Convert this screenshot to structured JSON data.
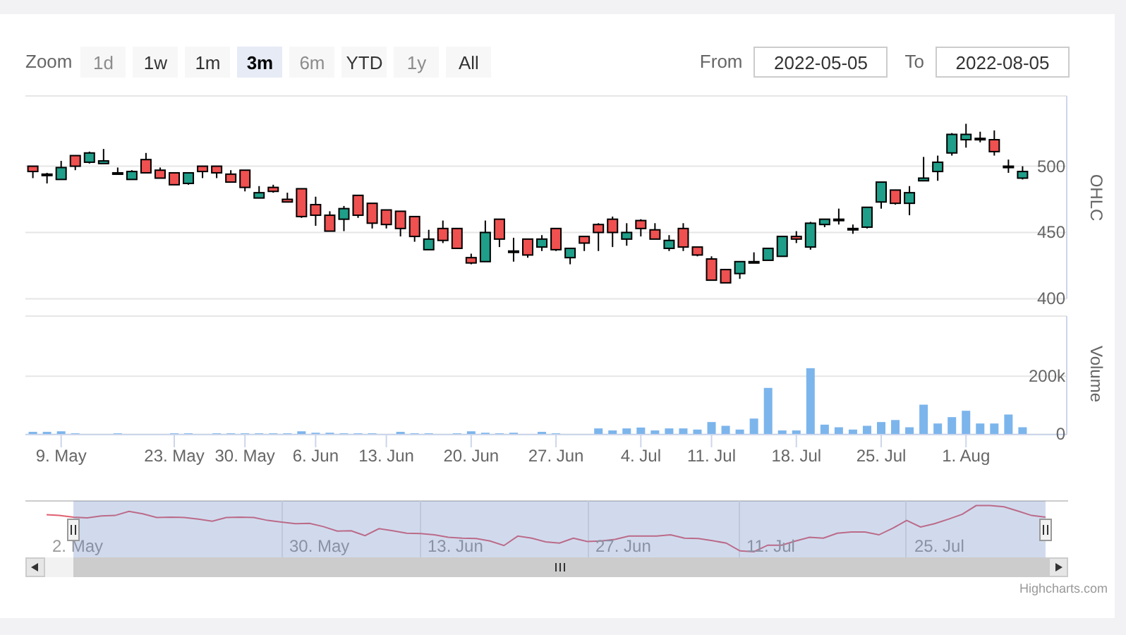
{
  "range_selector": {
    "label": "Zoom",
    "buttons": [
      {
        "label": "1d",
        "selected": false,
        "disabled": true
      },
      {
        "label": "1w",
        "selected": false,
        "disabled": false
      },
      {
        "label": "1m",
        "selected": false,
        "disabled": false
      },
      {
        "label": "3m",
        "selected": true,
        "disabled": false
      },
      {
        "label": "6m",
        "selected": false,
        "disabled": true
      },
      {
        "label": "YTD",
        "selected": false,
        "disabled": false
      },
      {
        "label": "1y",
        "selected": false,
        "disabled": true
      },
      {
        "label": "All",
        "selected": false,
        "disabled": false
      }
    ]
  },
  "date_range": {
    "from_label": "From",
    "from": "2022-05-05",
    "to_label": "To",
    "to": "2022-08-05"
  },
  "price_chart": {
    "chart_data": {
      "type": "candlestick",
      "ylabel": "OHLC",
      "ylim": [
        400,
        553
      ],
      "yticks": [
        400,
        450,
        500
      ],
      "categories": [
        null,
        null,
        null,
        null,
        null,
        null,
        null,
        null,
        null,
        null,
        null,
        null,
        null,
        null,
        null,
        null,
        null,
        null,
        null,
        null,
        null,
        null,
        null,
        null,
        null,
        null,
        null,
        null,
        null,
        null,
        null,
        null,
        null,
        null,
        null,
        null,
        null,
        null,
        null,
        null,
        null,
        null,
        null,
        null,
        null,
        null,
        null,
        null,
        null,
        null,
        null,
        null,
        null,
        null,
        null,
        null,
        null,
        null,
        null,
        null,
        null,
        null,
        null,
        null,
        null,
        null,
        null,
        null,
        null,
        null,
        null
      ],
      "ohlc": [
        [
          500,
          500,
          491,
          496
        ],
        [
          494,
          495,
          487,
          494
        ],
        [
          490,
          504,
          490,
          499
        ],
        [
          508,
          508,
          497,
          500
        ],
        [
          503,
          511,
          502,
          510
        ],
        [
          502,
          513,
          502,
          504
        ],
        [
          495,
          499,
          495,
          495
        ],
        [
          490,
          497,
          490,
          496
        ],
        [
          505,
          510,
          495,
          495
        ],
        [
          497,
          499,
          491,
          491
        ],
        [
          495,
          495,
          486,
          486
        ],
        [
          487,
          495,
          486,
          495
        ],
        [
          500,
          500,
          491,
          496
        ],
        [
          500,
          500,
          491,
          495
        ],
        [
          494,
          497,
          488,
          488
        ],
        [
          497,
          497,
          481,
          484
        ],
        [
          476,
          485,
          476,
          480
        ],
        [
          484,
          486,
          480,
          481
        ],
        [
          475,
          480,
          473,
          473
        ],
        [
          483,
          483,
          461,
          462
        ],
        [
          471,
          477,
          455,
          463
        ],
        [
          463,
          466,
          451,
          451
        ],
        [
          460,
          470,
          451,
          468
        ],
        [
          478,
          478,
          461,
          463
        ],
        [
          472,
          472,
          453,
          457
        ],
        [
          467,
          467,
          453,
          456
        ],
        [
          466,
          466,
          447,
          453
        ],
        [
          462,
          462,
          443,
          447
        ],
        [
          437,
          452,
          437,
          445
        ],
        [
          453,
          459,
          442,
          444
        ],
        [
          453,
          453,
          438,
          438
        ],
        [
          431,
          434,
          426,
          427
        ],
        [
          428,
          459,
          428,
          450
        ],
        [
          460,
          460,
          439,
          445
        ],
        [
          436,
          446,
          428,
          436
        ],
        [
          445,
          445,
          431,
          433
        ],
        [
          439,
          448,
          436,
          445
        ],
        [
          453,
          453,
          436,
          437
        ],
        [
          431,
          438,
          426,
          438
        ],
        [
          447,
          447,
          436,
          442
        ],
        [
          456,
          457,
          436,
          450
        ],
        [
          460,
          462,
          439,
          450
        ],
        [
          445,
          457,
          440,
          450
        ],
        [
          459,
          460,
          447,
          453
        ],
        [
          452,
          457,
          445,
          445
        ],
        [
          438,
          448,
          436,
          444
        ],
        [
          453,
          457,
          436,
          439
        ],
        [
          439,
          439,
          432,
          433
        ],
        [
          430,
          432,
          414,
          414
        ],
        [
          422,
          422,
          412,
          412
        ],
        [
          419,
          428,
          415,
          428
        ],
        [
          428,
          435,
          428,
          428
        ],
        [
          429,
          438,
          429,
          438
        ],
        [
          432,
          447,
          432,
          447
        ],
        [
          447,
          451,
          442,
          445
        ],
        [
          439,
          458,
          437,
          457
        ],
        [
          456,
          460,
          454,
          460
        ],
        [
          460,
          468,
          456,
          460
        ],
        [
          453,
          456,
          449,
          453
        ],
        [
          454,
          469,
          453,
          469
        ],
        [
          473,
          488,
          468,
          488
        ],
        [
          482,
          482,
          471,
          472
        ],
        [
          472,
          485,
          463,
          480
        ],
        [
          489,
          507,
          489,
          491
        ],
        [
          496,
          508,
          489,
          503
        ],
        [
          510,
          525,
          508,
          524
        ],
        [
          520,
          532,
          514,
          524
        ],
        [
          521,
          526,
          518,
          521
        ],
        [
          520,
          527,
          508,
          511
        ],
        [
          500,
          505,
          495,
          500
        ],
        [
          491,
          500,
          490,
          496
        ]
      ]
    }
  },
  "volume_chart": {
    "chart_data": {
      "type": "bar",
      "ylabel": "Volume",
      "ylim": [
        0,
        408000
      ],
      "categories": [
        null,
        null,
        "9. May",
        null,
        null,
        null,
        null,
        null,
        null,
        null,
        "23. May",
        null,
        null,
        null,
        null,
        "30. May",
        null,
        null,
        null,
        null,
        "6. Jun",
        null,
        null,
        null,
        null,
        "13. Jun",
        null,
        null,
        null,
        null,
        null,
        "20. Jun",
        null,
        null,
        null,
        null,
        null,
        "27. Jun",
        null,
        null,
        null,
        null,
        null,
        "4. Jul",
        null,
        null,
        null,
        null,
        "11. Jul",
        null,
        null,
        null,
        null,
        null,
        "18. Jul",
        null,
        null,
        null,
        null,
        null,
        "25. Jul",
        null,
        null,
        null,
        null,
        null,
        "1. Aug",
        null,
        null,
        null,
        null
      ],
      "yticks": [
        {
          "value": 0,
          "label": "0"
        },
        {
          "value": 200000,
          "label": "200k"
        }
      ],
      "series": [
        {
          "color": "#7cb5ec",
          "values": [
            8000,
            8000,
            10000,
            3000,
            0,
            0,
            3000,
            0,
            0,
            0,
            3000,
            3000,
            0,
            3000,
            3000,
            3000,
            3000,
            3000,
            3000,
            10000,
            5000,
            5000,
            3000,
            3000,
            3000,
            0,
            8000,
            3000,
            3000,
            0,
            3000,
            10000,
            5000,
            3000,
            5000,
            0,
            8000,
            3000,
            0,
            0,
            20000,
            13000,
            20000,
            23000,
            13000,
            20000,
            20000,
            16000,
            42000,
            29000,
            16000,
            54000,
            160000,
            13000,
            13000,
            228000,
            33000,
            24000,
            16000,
            29000,
            42000,
            49000,
            24000,
            102000,
            37000,
            59000,
            81000,
            37000,
            37000,
            68000,
            24000
          ]
        }
      ]
    }
  },
  "navigator": {
    "labels": [
      "2. May",
      "30. May",
      "13. Jun",
      "27. Jun",
      "11. Jul",
      "25. Jul"
    ]
  },
  "credits": "Highcharts.com"
}
